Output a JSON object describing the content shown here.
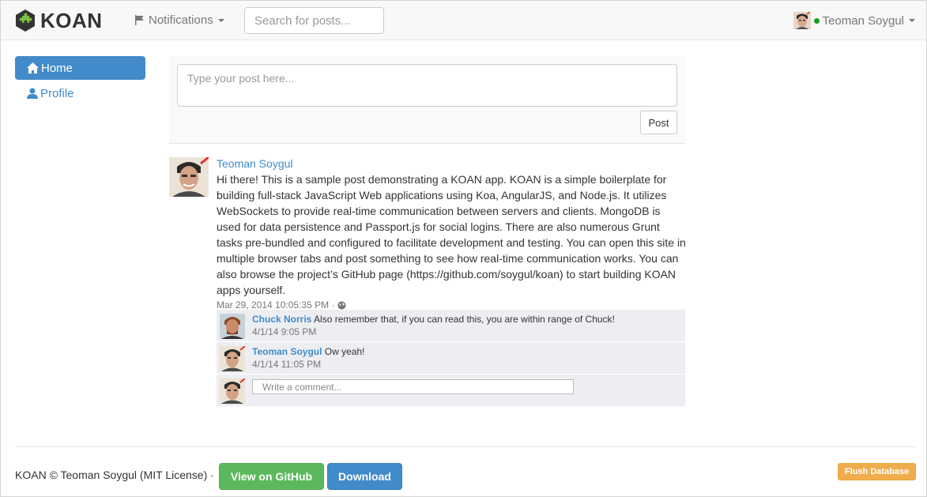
{
  "navbar": {
    "brand": "KOAN",
    "logo_icon": "puzzle-piece-hexagon-icon",
    "notifications_label": "Notifications",
    "search_placeholder": "Search for posts...",
    "user_name": "Teoman Soygul",
    "online_color": "#1a9c1a"
  },
  "sidebar": {
    "items": [
      {
        "label": "Home",
        "icon": "home-icon",
        "active": true
      },
      {
        "label": "Profile",
        "icon": "user-icon",
        "active": false
      }
    ]
  },
  "composer": {
    "placeholder": "Type your post here...",
    "post_label": "Post"
  },
  "post": {
    "author": "Teoman Soygul",
    "text": "Hi there! This is a sample post demonstrating a KOAN app. KOAN is a simple boilerplate for building full-stack JavaScript Web applications using Koa, AngularJS, and Node.js. It utilizes WebSockets to provide real-time communication between servers and clients. MongoDB is used for data persistence and Passport.js for social logins. There are also numerous Grunt tasks pre-bundled and configured to facilitate development and testing. You can open this site in multiple browser tabs and post something to see how real-time communication works. You can also browse the project’s GitHub page (https://github.com/soygul/koan) to start building KOAN apps yourself.",
    "timestamp": "Mar 29, 2014 10:05:35 PM ·",
    "comments": [
      {
        "author": "Chuck Norris",
        "text": "Also remember that, if you can read this, you are within range of Chuck!",
        "time": "4/1/14 9:05 PM"
      },
      {
        "author": "Teoman Soygul",
        "text": "Ow yeah!",
        "time": "4/1/14 11:05 PM"
      }
    ],
    "comment_placeholder": "Write a comment..."
  },
  "footer": {
    "text": "KOAN © Teoman Soygul (MIT License) ·",
    "github_label": "View on GitHub",
    "download_label": "Download",
    "flush_label": "Flush Database"
  },
  "colors": {
    "primary": "#428bca",
    "success": "#5cb85c",
    "warning": "#f0ad4e"
  }
}
